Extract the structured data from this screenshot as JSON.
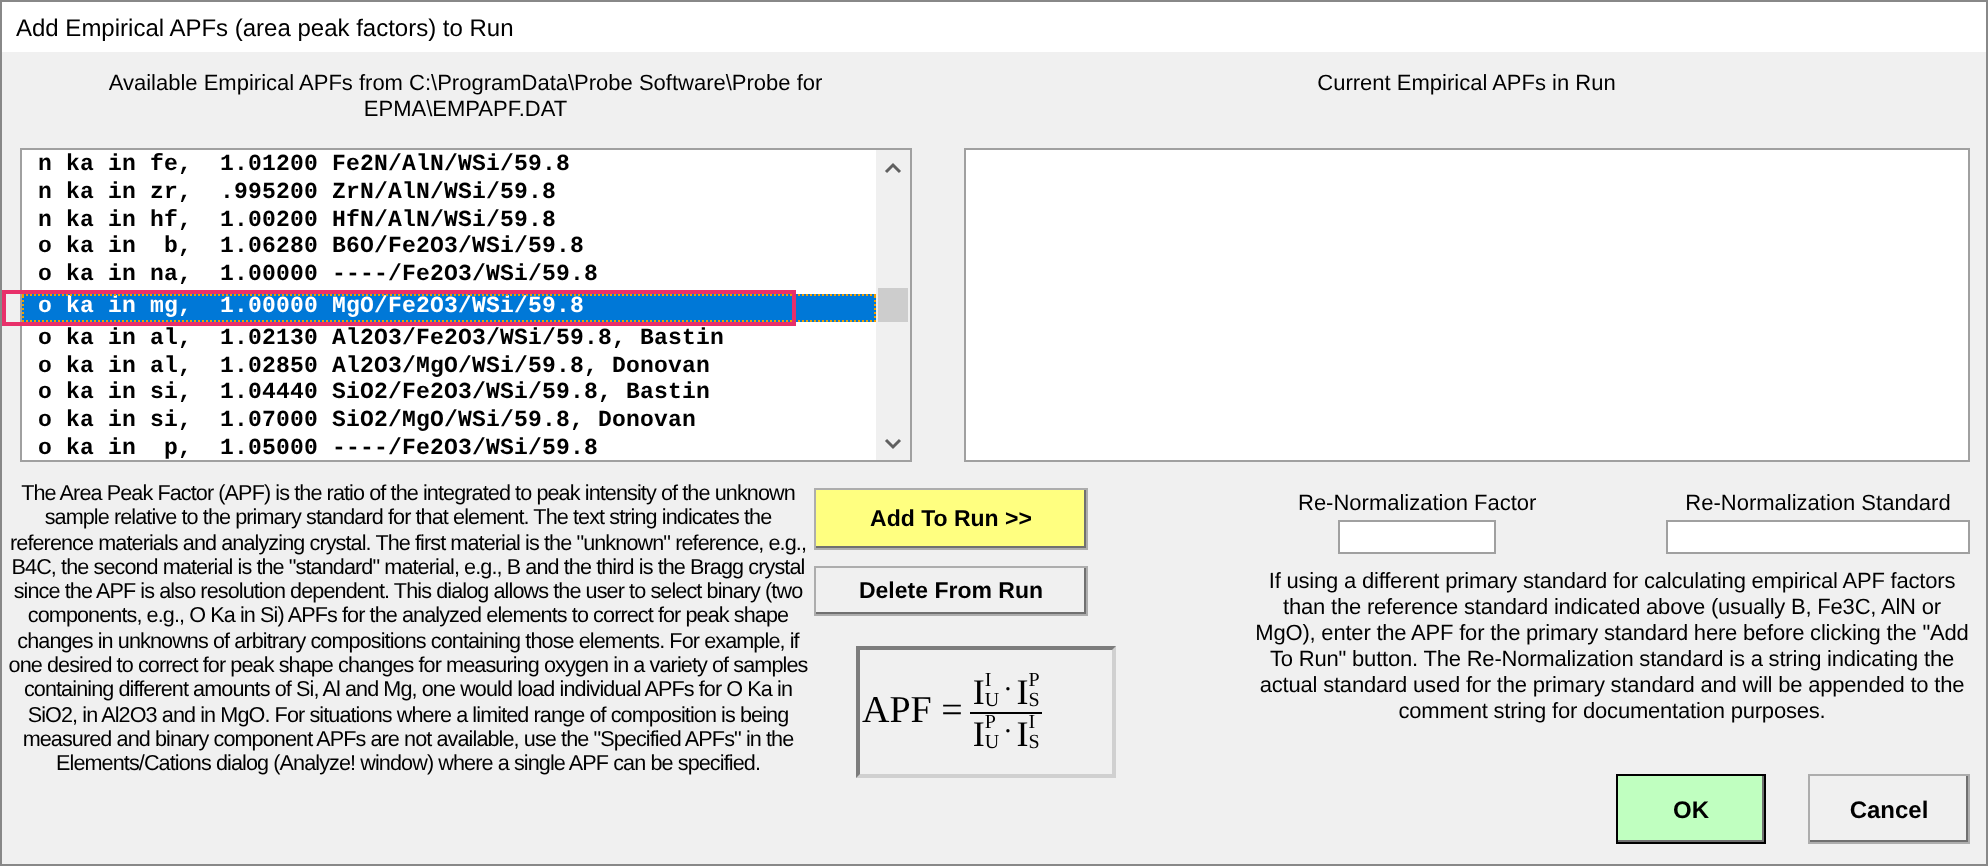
{
  "window": {
    "title": "Add Empirical APFs (area peak factors) to Run"
  },
  "available": {
    "heading": "Available Empirical APFs from C:\\ProgramData\\Probe Software\\Probe for EPMA\\EMPAPF.DAT",
    "items": [
      {
        "text": "n ka in fe,  1.01200 Fe2N/AlN/WSi/59.8",
        "selected": false,
        "highlighted": false
      },
      {
        "text": "n ka in zr,  .995200 ZrN/AlN/WSi/59.8",
        "selected": false,
        "highlighted": false
      },
      {
        "text": "n ka in hf,  1.00200 HfN/AlN/WSi/59.8",
        "selected": false,
        "highlighted": false
      },
      {
        "text": "o ka in  b,  1.06280 B6O/Fe2O3/WSi/59.8",
        "selected": false,
        "highlighted": false
      },
      {
        "text": "o ka in na,  1.00000 ----/Fe2O3/WSi/59.8",
        "selected": false,
        "highlighted": false
      },
      {
        "text": "o ka in mg,  1.00000 MgO/Fe2O3/WSi/59.8",
        "selected": true,
        "highlighted": true
      },
      {
        "text": "o ka in al,  1.02130 Al2O3/Fe2O3/WSi/59.8, Bastin",
        "selected": false,
        "highlighted": false
      },
      {
        "text": "o ka in al,  1.02850 Al2O3/MgO/WSi/59.8, Donovan",
        "selected": false,
        "highlighted": false
      },
      {
        "text": "o ka in si,  1.04440 SiO2/Fe2O3/WSi/59.8, Bastin",
        "selected": false,
        "highlighted": false
      },
      {
        "text": "o ka in si,  1.07000 SiO2/MgO/WSi/59.8, Donovan",
        "selected": false,
        "highlighted": false
      },
      {
        "text": "o ka in  p,  1.05000 ----/Fe2O3/WSi/59.8",
        "selected": false,
        "highlighted": false
      }
    ]
  },
  "current": {
    "heading": "Current Empirical APFs in Run"
  },
  "description": "The Area Peak Factor (APF) is the ratio of the integrated to peak intensity of the unknown sample relative to the primary standard for that element. The text string indicates the reference materials and analyzing crystal. The first material is the \"unknown\" reference, e.g., B4C, the second material is the \"standard\" material, e.g., B and the third is the Bragg crystal since the APF is also resolution dependent. This dialog allows the user to select binary (two components, e.g., O Ka in Si) APFs for the analyzed elements to correct for peak shape changes in unknowns of arbitrary compositions containing those elements. For example, if one desired to correct for peak shape changes for measuring oxygen in a variety of samples containing different amounts of Si, Al and Mg, one would load individual APFs for O Ka in SiO2, in Al2O3 and in MgO. For situations where a limited range of composition is being measured and binary component APFs are not available, use the \"Specified APFs\" in the Elements/Cations dialog (Analyze! window) where a single APF can be specified.",
  "buttons": [
    {
      "label": "Add To Run >>",
      "kind": "add"
    },
    {
      "label": "Delete From Run",
      "kind": "delete"
    }
  ],
  "formula": {
    "lhs": "APF",
    "equals": "=",
    "dot": "·",
    "numerator": [
      {
        "base": "I",
        "sup": "I",
        "sub": "U"
      },
      {
        "base": "I",
        "sup": "P",
        "sub": "S"
      }
    ],
    "denominator": [
      {
        "base": "I",
        "sup": "P",
        "sub": "U"
      },
      {
        "base": "I",
        "sup": "I",
        "sub": "S"
      }
    ]
  },
  "renormalization": {
    "fields": [
      {
        "label": "Re-Normalization Factor",
        "kind": "factor"
      },
      {
        "label": "Re-Normalization Standard",
        "kind": "standard"
      }
    ],
    "note": "If using a different primary standard for calculating empirical APF factors than the reference standard indicated above (usually B, Fe3C, AlN or MgO), enter the APF for the primary standard here before clicking the \"Add To Run\" button. The Re-Normalization standard is a string indicating the actual standard used for the primary standard and will be appended to the comment string for documentation purposes."
  },
  "dialog_buttons": [
    {
      "label": "OK",
      "kind": "ok"
    },
    {
      "label": "Cancel",
      "kind": "cancel"
    }
  ]
}
